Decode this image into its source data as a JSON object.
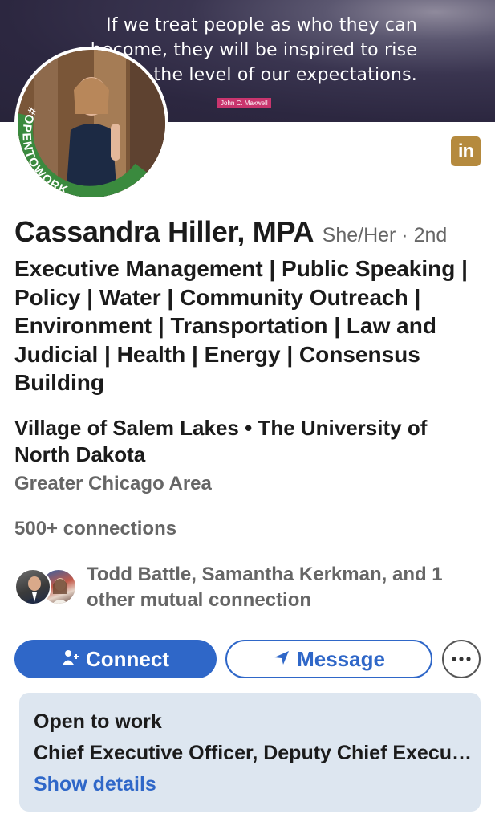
{
  "banner": {
    "quote": "If we treat people as who they can become, they will be inspired to rise to the level of our expectations.",
    "author": "John C. Maxwell"
  },
  "profile": {
    "open_to_work_frame": "#OPENTOWORK",
    "name": "Cassandra Hiller, MPA",
    "pronouns_degree": "She/Her · 2nd",
    "headline": "Executive Management | Public Speaking | Policy | Water | Community Outreach | Environment | Transportation | Law and Judicial | Health  | Energy | Consensus Building",
    "organizations": "Village of Salem Lakes • The University of North Dakota",
    "location": "Greater Chicago Area",
    "connections": "500+ connections",
    "mutual_connections": "Todd Battle, Samantha Kerkman, and 1 other mutual connection"
  },
  "actions": {
    "connect_label": "Connect",
    "message_label": "Message",
    "more_label": "···"
  },
  "open_to_work": {
    "title": "Open to work",
    "roles": "Chief Executive Officer, Deputy Chief Executive Officer",
    "details_link": "Show details"
  },
  "icons": {
    "linkedin_logo": "in",
    "connect": "person-add-icon",
    "message": "send-icon",
    "more": "ellipsis-icon"
  },
  "colors": {
    "primary": "#2f67c8",
    "open_to_work_green": "#2e7d32",
    "card_bg": "#dde6f0",
    "linkedin_logo_bg": "#b58a3e"
  }
}
